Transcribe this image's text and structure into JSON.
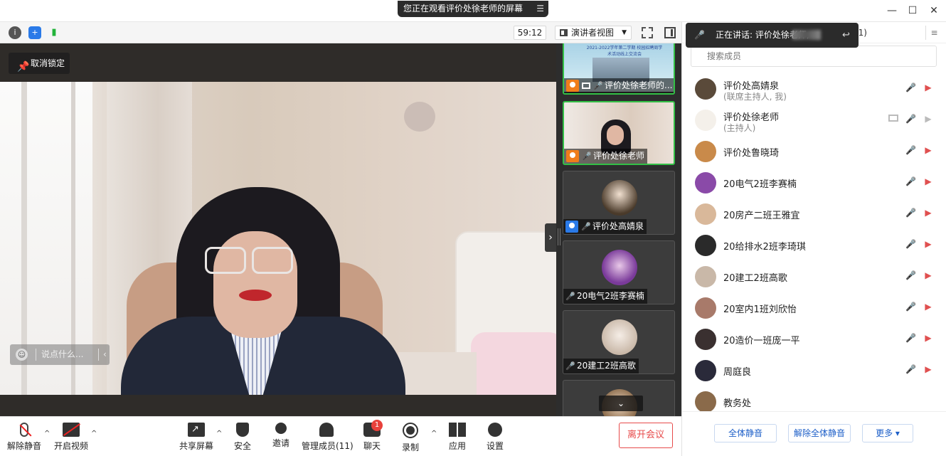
{
  "titlebar": {
    "share_banner": "您正在观看评价处徐老师的屏幕",
    "minimize": "—",
    "maximize": "☐",
    "close": "✕"
  },
  "toolbar": {
    "info_icon": "i",
    "security_icon": "+",
    "signal_icon": "▮",
    "timer": "59:12",
    "view_mode": "演讲者视图",
    "view_caret": "▼"
  },
  "main_video": {
    "unlock_label": "取消锁定",
    "chat_placeholder": "说点什么...",
    "chat_arrow": "‹",
    "collapse_arrow": "›"
  },
  "gallery": {
    "tiles": [
      {
        "name": "评价处徐老师的...",
        "badge": "orange"
      },
      {
        "name": "评价处徐老师",
        "badge": "orange"
      },
      {
        "name": "评价处高婧泉",
        "badge": "blue"
      },
      {
        "name": "20电气2班李赛楠"
      },
      {
        "name": "20建工2班高歌"
      }
    ],
    "shared_doc_title": "2021-2022学年第二学期 校园招聘周学术活动线上交流会",
    "down_arrow": "⌄"
  },
  "speaking_toast": {
    "text": "正在讲话: 评价处徐老师;",
    "count_suffix": "11)"
  },
  "participants_panel": {
    "search_placeholder": "搜索成员",
    "members": [
      {
        "name": "评价处高婧泉",
        "role": "(联席主持人, 我)",
        "mic": "muted",
        "cam": "off",
        "avatar_color": "#5a4a3a"
      },
      {
        "name": "评价处徐老师",
        "role": "(主持人)",
        "mic": "on",
        "cam": "gray",
        "share": true,
        "avatar_color": "#f4f0ea"
      },
      {
        "name": "评价处鲁晓琦",
        "role": "",
        "mic": "gray",
        "cam": "off",
        "avatar_color": "#c98a4a"
      },
      {
        "name": "20电气2班李赛楠",
        "role": "",
        "mic": "muted",
        "cam": "off",
        "avatar_color": "#8a4aa8"
      },
      {
        "name": "20房产二班王雅宜",
        "role": "",
        "mic": "muted",
        "cam": "off",
        "avatar_color": "#d9b89a"
      },
      {
        "name": "20给排水2班李琦琪",
        "role": "",
        "mic": "muted",
        "cam": "off",
        "avatar_color": "#2a2a2a"
      },
      {
        "name": "20建工2班高歌",
        "role": "",
        "mic": "muted",
        "cam": "off",
        "avatar_color": "#c9b8a8"
      },
      {
        "name": "20室内1班刘欣怡",
        "role": "",
        "mic": "muted",
        "cam": "off",
        "avatar_color": "#a87a6a"
      },
      {
        "name": "20造价一班庞一平",
        "role": "",
        "mic": "muted",
        "cam": "off",
        "avatar_color": "#3a3030"
      },
      {
        "name": "周庭良",
        "role": "",
        "mic": "muted",
        "cam": "off",
        "avatar_color": "#2a2a3a"
      },
      {
        "name": "教务处",
        "role": "",
        "mic": "",
        "cam": "",
        "avatar_color": "#8a6a4a"
      }
    ],
    "footer": {
      "mute_all": "全体静音",
      "unmute_all": "解除全体静音",
      "more": "更多 ▾"
    }
  },
  "bottombar": {
    "unmute": "解除静音",
    "start_video": "开启视频",
    "share_screen": "共享屏幕",
    "security": "安全",
    "invite": "邀请",
    "manage_members": "管理成员(11)",
    "chat": "聊天",
    "chat_badge": "1",
    "record": "录制",
    "apps": "应用",
    "settings": "设置",
    "leave": "离开会议",
    "caret": "^"
  },
  "colors": {
    "accent_green": "#33c046",
    "leave_red": "#e74a4a",
    "link_blue": "#1d5fc8",
    "muted_red": "#e05050"
  }
}
